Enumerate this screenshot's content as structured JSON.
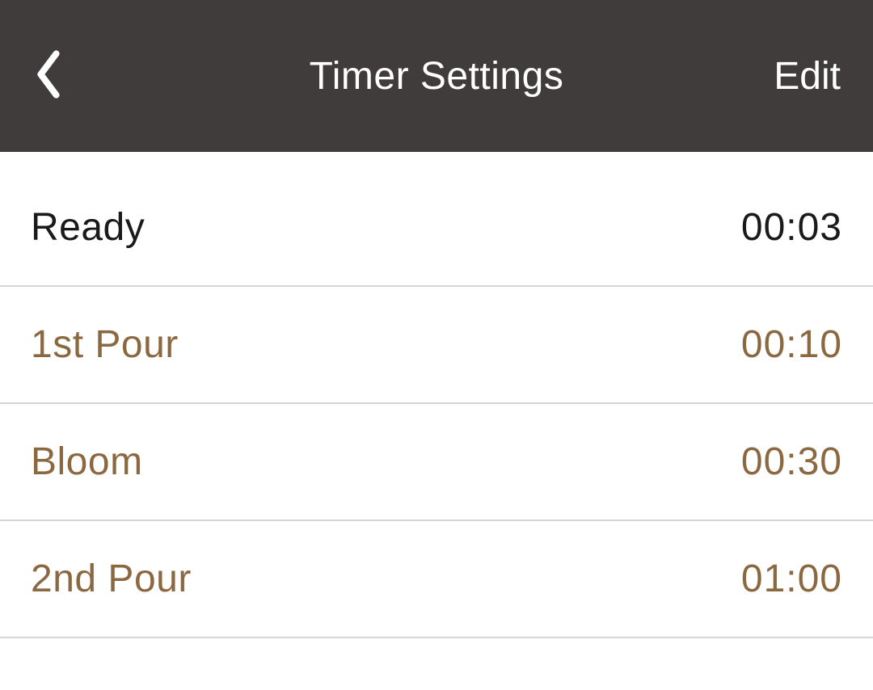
{
  "header": {
    "title": "Timer Settings",
    "edit_label": "Edit"
  },
  "rows": [
    {
      "label": "Ready",
      "time": "00:03",
      "active": true
    },
    {
      "label": "1st Pour",
      "time": "00:10",
      "active": false
    },
    {
      "label": "Bloom",
      "time": "00:30",
      "active": false
    },
    {
      "label": "2nd Pour",
      "time": "01:00",
      "active": false
    }
  ]
}
